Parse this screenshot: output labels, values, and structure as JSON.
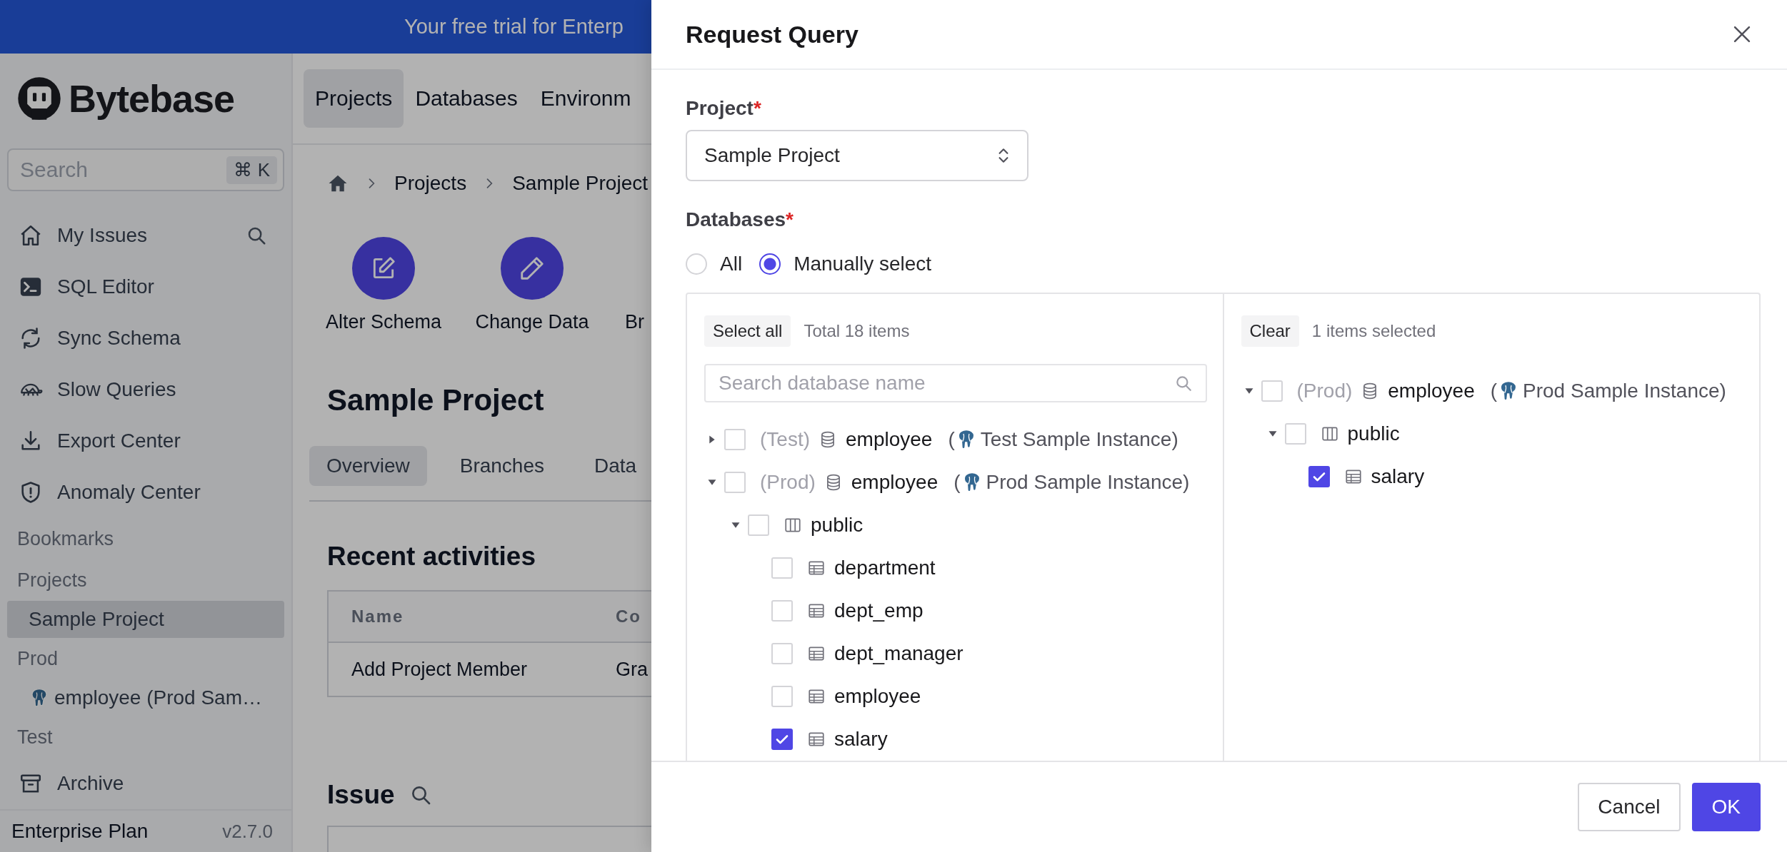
{
  "banner": {
    "text": "Your free trial for Enterp"
  },
  "sidebar": {
    "brand": "Bytebase",
    "search": {
      "placeholder": "Search",
      "shortcut": "⌘ K"
    },
    "items": [
      {
        "kind": "nav",
        "label": "My Issues",
        "selected": false
      },
      {
        "kind": "nav",
        "label": "SQL Editor",
        "selected": false
      },
      {
        "kind": "nav",
        "label": "Sync Schema",
        "selected": false
      },
      {
        "kind": "nav",
        "label": "Slow Queries",
        "selected": false
      },
      {
        "kind": "nav",
        "label": "Export Center",
        "selected": false
      },
      {
        "kind": "nav",
        "label": "Anomaly Center",
        "selected": false
      },
      {
        "kind": "heading",
        "label": "Bookmarks"
      },
      {
        "kind": "heading",
        "label": "Projects"
      },
      {
        "kind": "link",
        "label": "Sample Project",
        "selected": true
      },
      {
        "kind": "heading",
        "label": "Prod"
      },
      {
        "kind": "link",
        "label": "employee (Prod Sam…",
        "selected": false
      },
      {
        "kind": "heading",
        "label": "Test"
      },
      {
        "kind": "nav",
        "label": "Archive",
        "selected": false
      }
    ],
    "footer": {
      "plan": "Enterprise Plan",
      "version": "v2.7.0"
    }
  },
  "main": {
    "top_tabs": [
      {
        "label": "Projects",
        "selected": true
      },
      {
        "label": "Databases",
        "selected": false
      },
      {
        "label": "Environm",
        "selected": false
      }
    ],
    "breadcrumb": [
      "Projects",
      "Sample Project"
    ],
    "quick_actions": [
      {
        "label": "Alter Schema"
      },
      {
        "label": "Change Data"
      },
      {
        "label": "Br"
      }
    ],
    "title": "Sample Project",
    "tabs": [
      {
        "label": "Overview",
        "selected": true
      },
      {
        "label": "Branches",
        "selected": false
      },
      {
        "label": "Data",
        "selected": false
      }
    ],
    "recent": {
      "title": "Recent activities",
      "columns": [
        "Name",
        "Co"
      ],
      "rows": [
        [
          "Add Project Member",
          "Gra"
        ]
      ]
    },
    "issue": {
      "title": "Issue"
    }
  },
  "drawer": {
    "title": "Request Query",
    "project": {
      "label": "Project",
      "required": "*",
      "value": "Sample Project"
    },
    "databases": {
      "label": "Databases",
      "required": "*",
      "options": [
        {
          "label": "All",
          "selected": false
        },
        {
          "label": "Manually select",
          "selected": true
        }
      ]
    },
    "source": {
      "action": "Select all",
      "summary": "Total 18 items",
      "search_placeholder": "Search database name",
      "tree": [
        {
          "kind": "database",
          "expanded": false,
          "checked": false,
          "env": "(Test)",
          "label": "employee",
          "instance_prefix": "(",
          "instance": "Test Sample Instance)"
        },
        {
          "kind": "database",
          "expanded": true,
          "checked": false,
          "env": "(Prod)",
          "label": "employee",
          "instance_prefix": "(",
          "instance": "Prod Sample Instance)",
          "children": [
            {
              "kind": "schema",
              "expanded": true,
              "checked": false,
              "label": "public",
              "children": [
                {
                  "kind": "table",
                  "checked": false,
                  "label": "department"
                },
                {
                  "kind": "table",
                  "checked": false,
                  "label": "dept_emp"
                },
                {
                  "kind": "table",
                  "checked": false,
                  "label": "dept_manager"
                },
                {
                  "kind": "table",
                  "checked": false,
                  "label": "employee"
                },
                {
                  "kind": "table",
                  "checked": true,
                  "label": "salary"
                }
              ]
            }
          ]
        }
      ]
    },
    "target": {
      "action": "Clear",
      "summary": "1 items selected",
      "tree": [
        {
          "kind": "database",
          "expanded": true,
          "checked": false,
          "env": "(Prod)",
          "label": "employee",
          "instance_prefix": "(",
          "instance": "Prod Sample Instance)",
          "children": [
            {
              "kind": "schema",
              "expanded": true,
              "checked": false,
              "label": "public",
              "children": [
                {
                  "kind": "table",
                  "checked": true,
                  "label": "salary"
                }
              ]
            }
          ]
        }
      ]
    },
    "buttons": [
      {
        "kind": "secondary",
        "label": "Cancel"
      },
      {
        "kind": "primary",
        "label": "OK"
      }
    ]
  }
}
